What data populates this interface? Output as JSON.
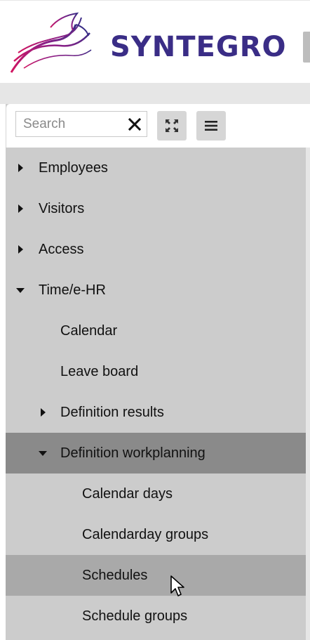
{
  "app": {
    "brand": "SYNTEGRO",
    "colors": {
      "brand": "#3a2d86",
      "logo_magenta": "#b0186e",
      "selected_row": "#8a8a8a",
      "hover_row": "#a9a9a9",
      "panel": "#cccccc"
    }
  },
  "toolbar": {
    "search_placeholder": "Search",
    "search_value": "",
    "clear_icon": "close-icon",
    "expand_icon": "expand-all-icon",
    "menu_icon": "hamburger-menu-icon"
  },
  "tree": [
    {
      "label": "Employees",
      "level": 0,
      "expander": "collapsed"
    },
    {
      "label": "Visitors",
      "level": 0,
      "expander": "collapsed"
    },
    {
      "label": "Access",
      "level": 0,
      "expander": "collapsed"
    },
    {
      "label": "Time/e-HR",
      "level": 0,
      "expander": "expanded"
    },
    {
      "label": "Calendar",
      "level": 1,
      "expander": "none"
    },
    {
      "label": "Leave board",
      "level": 1,
      "expander": "none"
    },
    {
      "label": "Definition results",
      "level": 1,
      "expander": "collapsed"
    },
    {
      "label": "Definition workplanning",
      "level": 1,
      "expander": "expanded",
      "state": "selected"
    },
    {
      "label": "Calendar days",
      "level": 2,
      "expander": "none"
    },
    {
      "label": "Calendarday groups",
      "level": 2,
      "expander": "none"
    },
    {
      "label": "Schedules",
      "level": 2,
      "expander": "none",
      "state": "hover"
    },
    {
      "label": "Schedule groups",
      "level": 2,
      "expander": "none"
    }
  ]
}
